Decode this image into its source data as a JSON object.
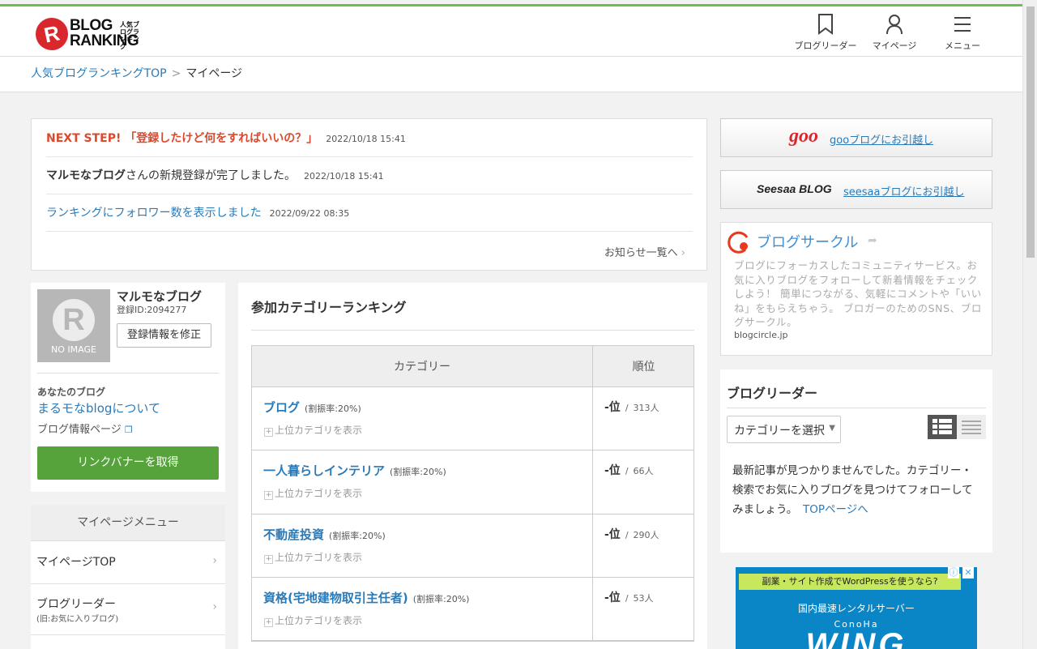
{
  "header": {
    "logo_text_1": "BLOG",
    "logo_text_2": "RANKING",
    "logo_small": "人気ブログランキング",
    "nav": [
      {
        "label": "ブログリーダー",
        "icon": "bookmark-icon"
      },
      {
        "label": "マイページ",
        "icon": "user-icon"
      },
      {
        "label": "メニュー",
        "icon": "hamburger-menu-icon"
      }
    ]
  },
  "breadcrumb": {
    "home": "人気ブログランキングTOP",
    "sep": ">",
    "current": "マイページ"
  },
  "news": {
    "items": [
      {
        "text": "NEXT STEP! 「登録したけど何をすればいいの？」",
        "date": "2022/10/18 15:41"
      },
      {
        "text_bold": "マルモなブログ",
        "text_rest": "さんの新規登録が完了しました。",
        "date": "2022/10/18 15:41"
      },
      {
        "text": "ランキングにフォロワー数を表示しました",
        "date": "2022/09/22 08:35"
      }
    ],
    "more": "お知らせ一覧へ"
  },
  "profile": {
    "noimage": "NO IMAGE",
    "name": "マルモなブログ",
    "reg_id": "登録ID:2094277",
    "edit_button": "登録情報を修正",
    "your_blog_label": "あなたのブログ",
    "blog_name": "まるモなblogについて",
    "blog_info": "ブログ情報ページ",
    "banner_button": "リンクバナーを取得"
  },
  "mypage_menu": {
    "title": "マイページメニュー",
    "items": [
      {
        "label": "マイページTOP",
        "sub": ""
      },
      {
        "label": "ブログリーダー",
        "sub": "(旧:お気に入りブログ)"
      }
    ]
  },
  "ranking": {
    "title": "参加カテゴリーランキング",
    "col_category": "カテゴリー",
    "col_rank": "順位",
    "show_parent": "上位カテゴリを表示",
    "rows": [
      {
        "name": "ブログ",
        "rate": "(割振率:20%)",
        "rank": "-位",
        "slash": "/",
        "count": "313人"
      },
      {
        "name": "一人暮らしインテリア",
        "rate": "(割振率:20%)",
        "rank": "-位",
        "slash": "/",
        "count": "66人"
      },
      {
        "name": "不動産投資",
        "rate": "(割振率:20%)",
        "rank": "-位",
        "slash": "/",
        "count": "290人"
      },
      {
        "name": "資格(宅地建物取引主任者)",
        "rate": "(割振率:20%)",
        "rank": "-位",
        "slash": "/",
        "count": "53人"
      }
    ]
  },
  "sidebar": {
    "goo": {
      "logo": "goo",
      "link": "gooブログにお引越し"
    },
    "seesaa": {
      "logo": "Seesaa BLOG",
      "link": "seesaaブログにお引越し"
    },
    "circle": {
      "title": "ブログサークル",
      "desc": "ブログにフォーカスしたコミュニティサービス。お気に入りブログをフォローして新着情報をチェックしよう！ 簡単につながる、気軽にコメントや「いいね」をもらえちゃう。 ブロガーのためのSNS、ブログサークル。",
      "url": "blogcircle.jp"
    },
    "reader": {
      "title": "ブログリーダー",
      "select": "カテゴリーを選択",
      "message": "最新記事が見つかりませんでした。カテゴリー・検索でお気に入りブログを見つけてフォローしてみましょう。",
      "link": "TOPページへ"
    },
    "ad": {
      "top": "副業・サイト作成でWordPressを使うなら?",
      "mid": "国内最速レンタルサーバー",
      "brand": "ConoHa",
      "big": "WING"
    }
  },
  "colors": {
    "accent_green": "#6cc04a",
    "link": "#2a7ab8",
    "news_red": "#d94a2f",
    "button_green": "#55a33a"
  }
}
